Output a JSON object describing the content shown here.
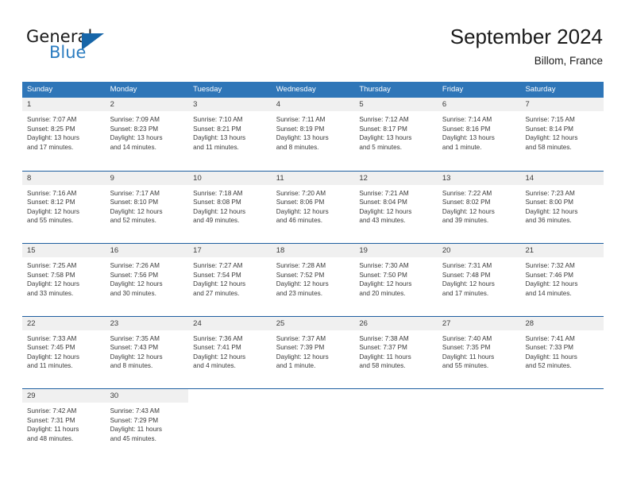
{
  "brand": {
    "name_part1": "General",
    "name_part2": "Blue",
    "triangle_color": "#1665a8",
    "blue_text_color": "#2b7cc0"
  },
  "header": {
    "title": "September 2024",
    "location": "Billom, France"
  },
  "theme": {
    "header_blue": "#2f76b8",
    "row_divider_blue": "#1f5fa0",
    "daynum_band": "#f0f0f0",
    "text": "#3a3a3a"
  },
  "weekdays": [
    "Sunday",
    "Monday",
    "Tuesday",
    "Wednesday",
    "Thursday",
    "Friday",
    "Saturday"
  ],
  "weeks": [
    [
      {
        "day": "1",
        "sunrise": "Sunrise: 7:07 AM",
        "sunset": "Sunset: 8:25 PM",
        "daylight1": "Daylight: 13 hours",
        "daylight2": "and 17 minutes."
      },
      {
        "day": "2",
        "sunrise": "Sunrise: 7:09 AM",
        "sunset": "Sunset: 8:23 PM",
        "daylight1": "Daylight: 13 hours",
        "daylight2": "and 14 minutes."
      },
      {
        "day": "3",
        "sunrise": "Sunrise: 7:10 AM",
        "sunset": "Sunset: 8:21 PM",
        "daylight1": "Daylight: 13 hours",
        "daylight2": "and 11 minutes."
      },
      {
        "day": "4",
        "sunrise": "Sunrise: 7:11 AM",
        "sunset": "Sunset: 8:19 PM",
        "daylight1": "Daylight: 13 hours",
        "daylight2": "and 8 minutes."
      },
      {
        "day": "5",
        "sunrise": "Sunrise: 7:12 AM",
        "sunset": "Sunset: 8:17 PM",
        "daylight1": "Daylight: 13 hours",
        "daylight2": "and 5 minutes."
      },
      {
        "day": "6",
        "sunrise": "Sunrise: 7:14 AM",
        "sunset": "Sunset: 8:16 PM",
        "daylight1": "Daylight: 13 hours",
        "daylight2": "and 1 minute."
      },
      {
        "day": "7",
        "sunrise": "Sunrise: 7:15 AM",
        "sunset": "Sunset: 8:14 PM",
        "daylight1": "Daylight: 12 hours",
        "daylight2": "and 58 minutes."
      }
    ],
    [
      {
        "day": "8",
        "sunrise": "Sunrise: 7:16 AM",
        "sunset": "Sunset: 8:12 PM",
        "daylight1": "Daylight: 12 hours",
        "daylight2": "and 55 minutes."
      },
      {
        "day": "9",
        "sunrise": "Sunrise: 7:17 AM",
        "sunset": "Sunset: 8:10 PM",
        "daylight1": "Daylight: 12 hours",
        "daylight2": "and 52 minutes."
      },
      {
        "day": "10",
        "sunrise": "Sunrise: 7:18 AM",
        "sunset": "Sunset: 8:08 PM",
        "daylight1": "Daylight: 12 hours",
        "daylight2": "and 49 minutes."
      },
      {
        "day": "11",
        "sunrise": "Sunrise: 7:20 AM",
        "sunset": "Sunset: 8:06 PM",
        "daylight1": "Daylight: 12 hours",
        "daylight2": "and 46 minutes."
      },
      {
        "day": "12",
        "sunrise": "Sunrise: 7:21 AM",
        "sunset": "Sunset: 8:04 PM",
        "daylight1": "Daylight: 12 hours",
        "daylight2": "and 43 minutes."
      },
      {
        "day": "13",
        "sunrise": "Sunrise: 7:22 AM",
        "sunset": "Sunset: 8:02 PM",
        "daylight1": "Daylight: 12 hours",
        "daylight2": "and 39 minutes."
      },
      {
        "day": "14",
        "sunrise": "Sunrise: 7:23 AM",
        "sunset": "Sunset: 8:00 PM",
        "daylight1": "Daylight: 12 hours",
        "daylight2": "and 36 minutes."
      }
    ],
    [
      {
        "day": "15",
        "sunrise": "Sunrise: 7:25 AM",
        "sunset": "Sunset: 7:58 PM",
        "daylight1": "Daylight: 12 hours",
        "daylight2": "and 33 minutes."
      },
      {
        "day": "16",
        "sunrise": "Sunrise: 7:26 AM",
        "sunset": "Sunset: 7:56 PM",
        "daylight1": "Daylight: 12 hours",
        "daylight2": "and 30 minutes."
      },
      {
        "day": "17",
        "sunrise": "Sunrise: 7:27 AM",
        "sunset": "Sunset: 7:54 PM",
        "daylight1": "Daylight: 12 hours",
        "daylight2": "and 27 minutes."
      },
      {
        "day": "18",
        "sunrise": "Sunrise: 7:28 AM",
        "sunset": "Sunset: 7:52 PM",
        "daylight1": "Daylight: 12 hours",
        "daylight2": "and 23 minutes."
      },
      {
        "day": "19",
        "sunrise": "Sunrise: 7:30 AM",
        "sunset": "Sunset: 7:50 PM",
        "daylight1": "Daylight: 12 hours",
        "daylight2": "and 20 minutes."
      },
      {
        "day": "20",
        "sunrise": "Sunrise: 7:31 AM",
        "sunset": "Sunset: 7:48 PM",
        "daylight1": "Daylight: 12 hours",
        "daylight2": "and 17 minutes."
      },
      {
        "day": "21",
        "sunrise": "Sunrise: 7:32 AM",
        "sunset": "Sunset: 7:46 PM",
        "daylight1": "Daylight: 12 hours",
        "daylight2": "and 14 minutes."
      }
    ],
    [
      {
        "day": "22",
        "sunrise": "Sunrise: 7:33 AM",
        "sunset": "Sunset: 7:45 PM",
        "daylight1": "Daylight: 12 hours",
        "daylight2": "and 11 minutes."
      },
      {
        "day": "23",
        "sunrise": "Sunrise: 7:35 AM",
        "sunset": "Sunset: 7:43 PM",
        "daylight1": "Daylight: 12 hours",
        "daylight2": "and 8 minutes."
      },
      {
        "day": "24",
        "sunrise": "Sunrise: 7:36 AM",
        "sunset": "Sunset: 7:41 PM",
        "daylight1": "Daylight: 12 hours",
        "daylight2": "and 4 minutes."
      },
      {
        "day": "25",
        "sunrise": "Sunrise: 7:37 AM",
        "sunset": "Sunset: 7:39 PM",
        "daylight1": "Daylight: 12 hours",
        "daylight2": "and 1 minute."
      },
      {
        "day": "26",
        "sunrise": "Sunrise: 7:38 AM",
        "sunset": "Sunset: 7:37 PM",
        "daylight1": "Daylight: 11 hours",
        "daylight2": "and 58 minutes."
      },
      {
        "day": "27",
        "sunrise": "Sunrise: 7:40 AM",
        "sunset": "Sunset: 7:35 PM",
        "daylight1": "Daylight: 11 hours",
        "daylight2": "and 55 minutes."
      },
      {
        "day": "28",
        "sunrise": "Sunrise: 7:41 AM",
        "sunset": "Sunset: 7:33 PM",
        "daylight1": "Daylight: 11 hours",
        "daylight2": "and 52 minutes."
      }
    ],
    [
      {
        "day": "29",
        "sunrise": "Sunrise: 7:42 AM",
        "sunset": "Sunset: 7:31 PM",
        "daylight1": "Daylight: 11 hours",
        "daylight2": "and 48 minutes."
      },
      {
        "day": "30",
        "sunrise": "Sunrise: 7:43 AM",
        "sunset": "Sunset: 7:29 PM",
        "daylight1": "Daylight: 11 hours",
        "daylight2": "and 45 minutes."
      },
      {
        "day": "",
        "sunrise": "",
        "sunset": "",
        "daylight1": "",
        "daylight2": ""
      },
      {
        "day": "",
        "sunrise": "",
        "sunset": "",
        "daylight1": "",
        "daylight2": ""
      },
      {
        "day": "",
        "sunrise": "",
        "sunset": "",
        "daylight1": "",
        "daylight2": ""
      },
      {
        "day": "",
        "sunrise": "",
        "sunset": "",
        "daylight1": "",
        "daylight2": ""
      },
      {
        "day": "",
        "sunrise": "",
        "sunset": "",
        "daylight1": "",
        "daylight2": ""
      }
    ]
  ]
}
